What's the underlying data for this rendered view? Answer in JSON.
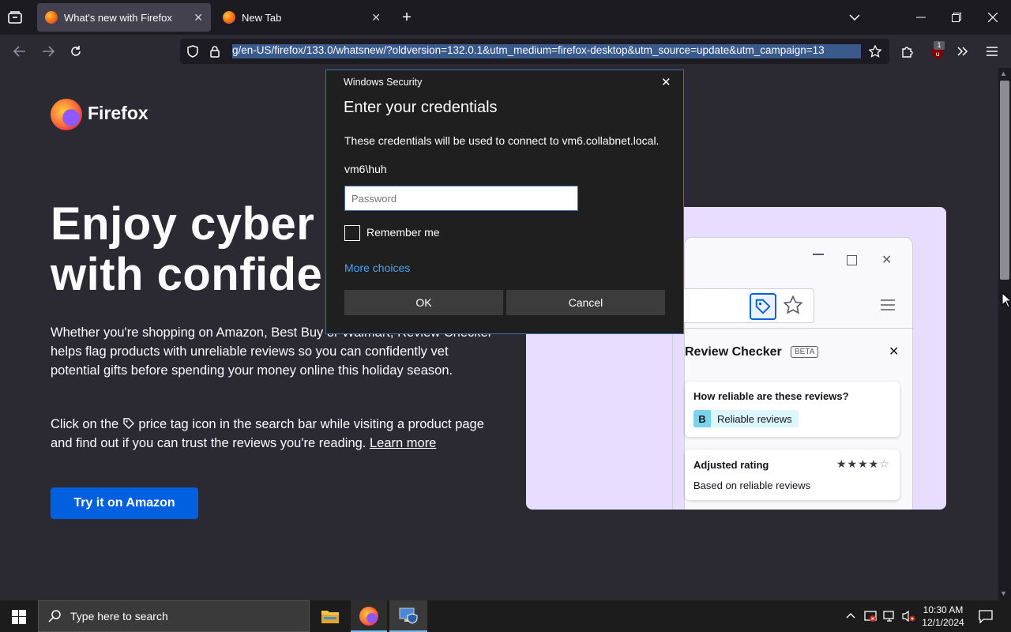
{
  "tabs": [
    {
      "title": "What's new with Firefox",
      "active": true
    },
    {
      "title": "New Tab",
      "active": false
    }
  ],
  "url": "g/en-US/firefox/133.0/whatsnew/?oldversion=132.0.1&utm_medium=firefox-desktop&utm_source=update&utm_campaign=13",
  "extension_badge": "1",
  "page": {
    "logo_text": "Firefox",
    "hero_line1": "Enjoy cyber s",
    "hero_line2": "with confiden",
    "para1": "Whether you're shopping on Amazon, Best Buy or Walmart, Review Checker helps flag products with unreliable reviews so you can confidently vet potential gifts before spending your money online this holiday season.",
    "para2_before": "Click on the",
    "para2_after": "price tag icon in the search bar while visiting a product page and find out if you can trust the reviews you're reading.",
    "learn_more": "Learn more",
    "cta_label": "Try it on Amazon"
  },
  "illustration": {
    "panel_title": "Review Checker",
    "beta_badge": "BETA",
    "card1_title": "How reliable are these reviews?",
    "grade": "B",
    "grade_label": "Reliable reviews",
    "card2_title": "Adjusted rating",
    "card2_sub": "Based on reliable reviews",
    "rating_stars": 4.5
  },
  "dialog": {
    "window_title": "Windows Security",
    "heading": "Enter your credentials",
    "message": "These credentials will be used to connect to vm6.collabnet.local.",
    "username": "vm6\\huh",
    "password_placeholder": "Password",
    "remember_label": "Remember me",
    "more_choices": "More choices",
    "ok_label": "OK",
    "cancel_label": "Cancel"
  },
  "taskbar": {
    "search_placeholder": "Type here to search",
    "time": "10:30 AM",
    "date": "12/1/2024"
  },
  "colors": {
    "accent_blue": "#0060df",
    "link_blue": "#4ca3f0",
    "dialog_border": "#3e6fb0"
  }
}
